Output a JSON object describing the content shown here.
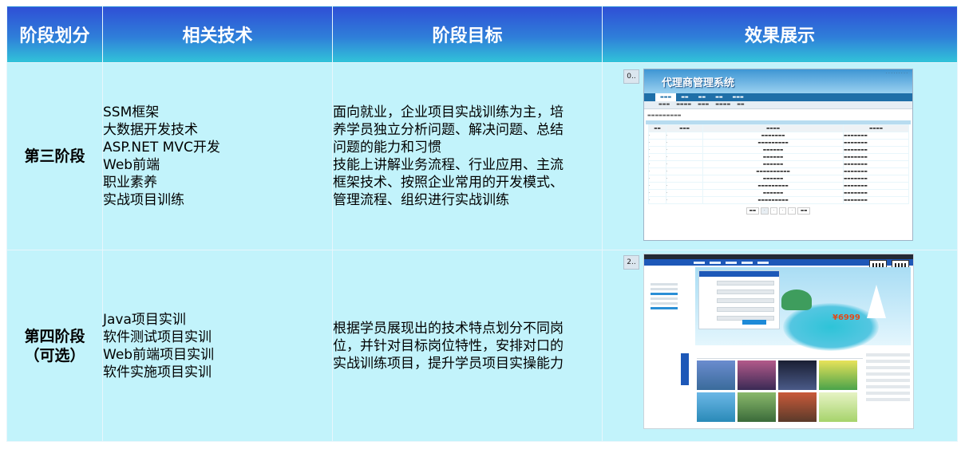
{
  "table": {
    "headers": [
      "阶段划分",
      "相关技术",
      "阶段目标",
      "效果展示"
    ],
    "rows": [
      {
        "phase": [
          "第三阶段"
        ],
        "tech": [
          "SSM框架",
          "大数据开发技术",
          "ASP.NET MVC开发",
          "Web前端",
          "职业素养",
          "实战项目训练"
        ],
        "goal": [
          "面向就业，企业项目实战训练为主，培",
          "养学员独立分析问题、解决问题、总结",
          "问题的能力和习惯",
          "技能上讲解业务流程、行业应用、主流",
          "框架技术、按照企业常用的开发模式、",
          "管理流程、组织进行实战训练"
        ],
        "tag": "0.."
      },
      {
        "phase": [
          "第四阶段",
          "（可选）"
        ],
        "tech": [
          "Java项目实训",
          "软件测试项目实训",
          "Web前端项目实训",
          "软件实施项目实训"
        ],
        "goal": [
          "根据学员展现出的技术特点划分不同岗",
          "位，并针对目标岗位特性，安排对口的",
          "实战训练项目，提升学员项目实操能力"
        ],
        "tag": "2.."
      }
    ]
  },
  "colors": {
    "header_top": "#2f4fd6",
    "header_bottom": "#31c4d9",
    "cell_bg": "#c2f3fb",
    "header_text": "#ffffff"
  }
}
